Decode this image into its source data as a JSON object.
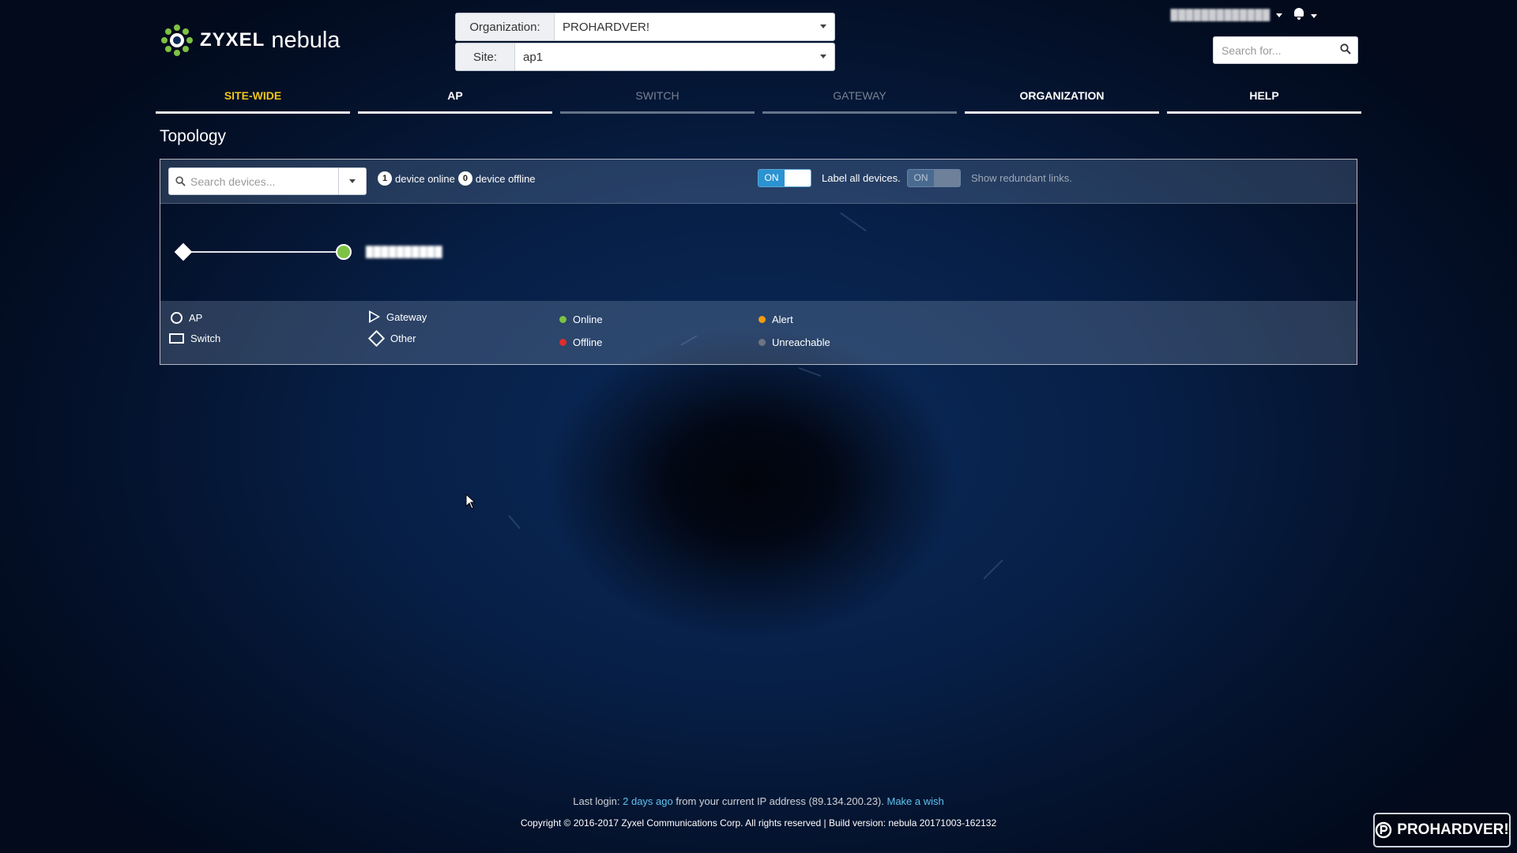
{
  "header": {
    "brand": "ZYXEL",
    "product": "nebula",
    "org_label": "Organization:",
    "org_value": "PROHARDVER!",
    "site_label": "Site:",
    "site_value": "ap1",
    "user_name": "█████████████",
    "search_placeholder": "Search for..."
  },
  "nav": {
    "tabs": [
      {
        "label": "SITE-WIDE",
        "state": "active"
      },
      {
        "label": "AP",
        "state": "enabled"
      },
      {
        "label": "SWITCH",
        "state": "disabled"
      },
      {
        "label": "GATEWAY",
        "state": "disabled"
      },
      {
        "label": "ORGANIZATION",
        "state": "enabled"
      },
      {
        "label": "HELP",
        "state": "enabled"
      }
    ]
  },
  "page": {
    "title": "Topology"
  },
  "toolbar": {
    "search_placeholder": "Search devices...",
    "online_count": "1",
    "online_text": "device online",
    "offline_count": "0",
    "offline_text": "device offline",
    "label_toggle_state": "ON",
    "label_toggle_text": "Label all devices.",
    "redundant_toggle_state": "ON",
    "redundant_toggle_text": "Show redundant links."
  },
  "topology": {
    "device_label": "██████████"
  },
  "legend": {
    "ap": "AP",
    "switch": "Switch",
    "gateway": "Gateway",
    "other": "Other",
    "online": "Online",
    "offline": "Offline",
    "alert": "Alert",
    "unreachable": "Unreachable"
  },
  "colors": {
    "online": "#7dc243",
    "offline": "#e02d2d",
    "alert": "#f39c12",
    "unreachable": "#6d7580",
    "active_tab": "#f0c419",
    "link": "#5fc2f0"
  },
  "footer": {
    "last_login_prefix": "Last login:",
    "last_login_link": "2 days ago",
    "last_login_middle": "from your current IP address (89.134.200.23).",
    "wish_link": "Make a wish",
    "copyright": "Copyright © 2016-2017 Zyxel Communications Corp. All rights reserved | Build version: nebula 20171003-162132"
  },
  "watermark": {
    "text": "PROHARDVER!"
  }
}
